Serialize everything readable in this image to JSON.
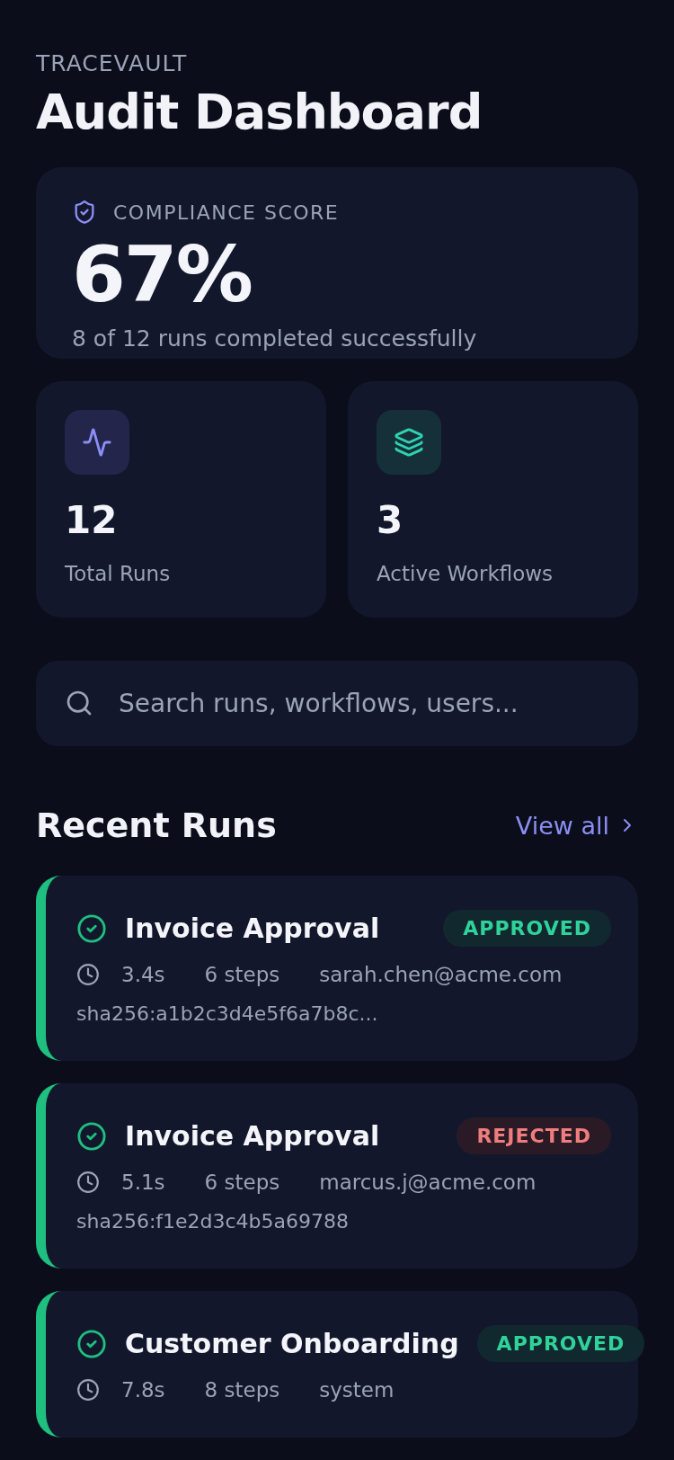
{
  "header": {
    "eyebrow": "TRACEVAULT",
    "title": "Audit Dashboard"
  },
  "score": {
    "label": "COMPLIANCE SCORE",
    "value": "67%",
    "caption": "8 of 12 runs completed successfully"
  },
  "stats": [
    {
      "kind": "runs",
      "value": "12",
      "label": "Total Runs"
    },
    {
      "kind": "workflows",
      "value": "3",
      "label": "Active Workflows"
    }
  ],
  "search": {
    "placeholder": "Search runs, workflows, users..."
  },
  "recent": {
    "title": "Recent Runs",
    "link": "View all"
  },
  "runs": [
    {
      "name": "Invoice Approval",
      "kind": "approved",
      "badge": "APPROVED",
      "duration": "3.4s",
      "steps": "6 steps",
      "user": "sarah.chen@acme.com",
      "hash": "sha256:a1b2c3d4e5f6a7b8c..."
    },
    {
      "name": "Invoice Approval",
      "kind": "rejected",
      "badge": "REJECTED",
      "duration": "5.1s",
      "steps": "6 steps",
      "user": "marcus.j@acme.com",
      "hash": "sha256:f1e2d3c4b5a69788"
    },
    {
      "name": "Customer Onboarding",
      "kind": "approved",
      "badge": "APPROVED",
      "duration": "7.8s",
      "steps": "8 steps",
      "user": "system"
    }
  ]
}
